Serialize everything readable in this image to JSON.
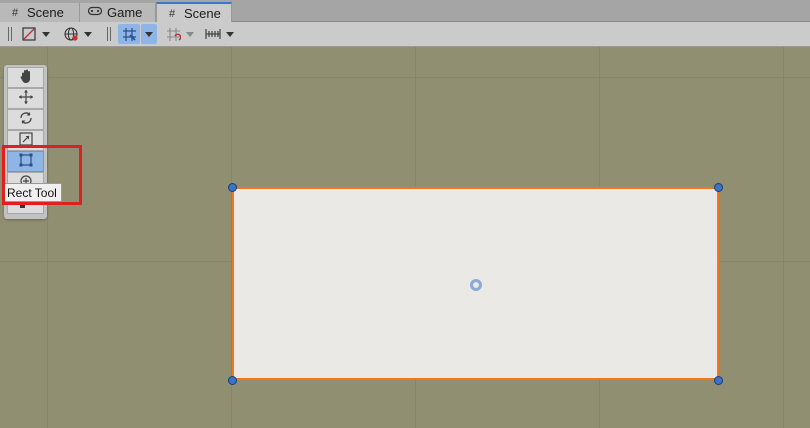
{
  "tabs": [
    {
      "label": "Scene",
      "icon": "grid-icon"
    },
    {
      "label": "Game",
      "icon": "gamepad-icon"
    },
    {
      "label": "Scene",
      "icon": "grid-icon",
      "active": true
    }
  ],
  "toolbar": {
    "items": [
      "shading-mode",
      "scene-visibility",
      "grid-snapping",
      "increment-snap",
      "ruler"
    ]
  },
  "tools": [
    "hand-tool",
    "move-tool",
    "rotate-tool",
    "scale-tool",
    "rect-tool",
    "transform-tool",
    "custom-tool"
  ],
  "selected_tool": "rect-tool",
  "tooltip": {
    "text": "Rect Tool"
  },
  "colors": {
    "scene_background": "#918f72",
    "selection_outline": "#f07818",
    "handle": "#3a73c8",
    "highlight": "#e02020",
    "selected_button": "#8fb4e6"
  }
}
